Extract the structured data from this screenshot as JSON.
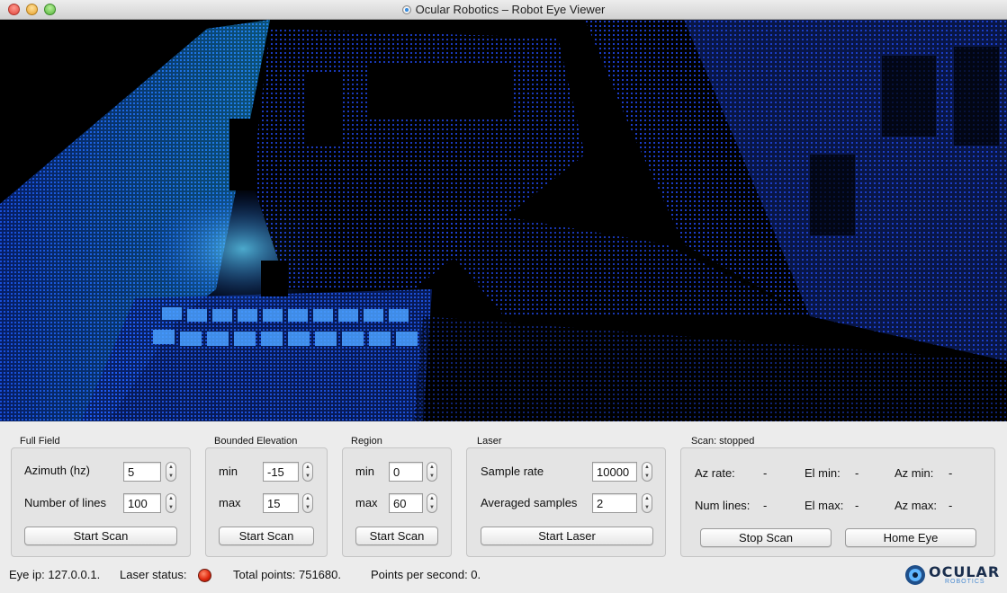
{
  "window": {
    "title": "Ocular Robotics – Robot Eye Viewer"
  },
  "viewport": {
    "description_icon": "point-cloud-3d-view"
  },
  "full_field": {
    "title": "Full Field",
    "azimuth_label": "Azimuth (hz)",
    "azimuth_value": "5",
    "lines_label": "Number of lines",
    "lines_value": "100",
    "button": "Start Scan"
  },
  "bounded_elevation": {
    "title": "Bounded Elevation",
    "min_label": "min",
    "min_value": "-15",
    "max_label": "max",
    "max_value": "15",
    "button": "Start Scan"
  },
  "region": {
    "title": "Region",
    "min_label": "min",
    "min_value": "0",
    "max_label": "max",
    "max_value": "60",
    "button": "Start Scan"
  },
  "laser": {
    "title": "Laser",
    "rate_label": "Sample rate",
    "rate_value": "10000",
    "avg_label": "Averaged samples",
    "avg_value": "2",
    "button": "Start Laser"
  },
  "scan": {
    "title": "Scan: stopped",
    "az_rate_label": "Az rate:",
    "az_rate_value": "-",
    "el_min_label": "El min:",
    "el_min_value": "-",
    "az_min_label": "Az min:",
    "az_min_value": "-",
    "num_lines_label": "Num lines:",
    "num_lines_value": "-",
    "el_max_label": "El max:",
    "el_max_value": "-",
    "az_max_label": "Az max:",
    "az_max_value": "-",
    "stop_button": "Stop Scan",
    "home_button": "Home Eye"
  },
  "status_bar": {
    "eye_ip": "Eye ip: 127.0.0.1.",
    "laser_status_label": "Laser status:",
    "laser_status_color": "#e02a10",
    "total_points": "Total points: 751680.",
    "points_per_second": "Points per second: 0."
  },
  "logo": {
    "name": "OCULAR",
    "tagline": "ROBOTICS"
  }
}
